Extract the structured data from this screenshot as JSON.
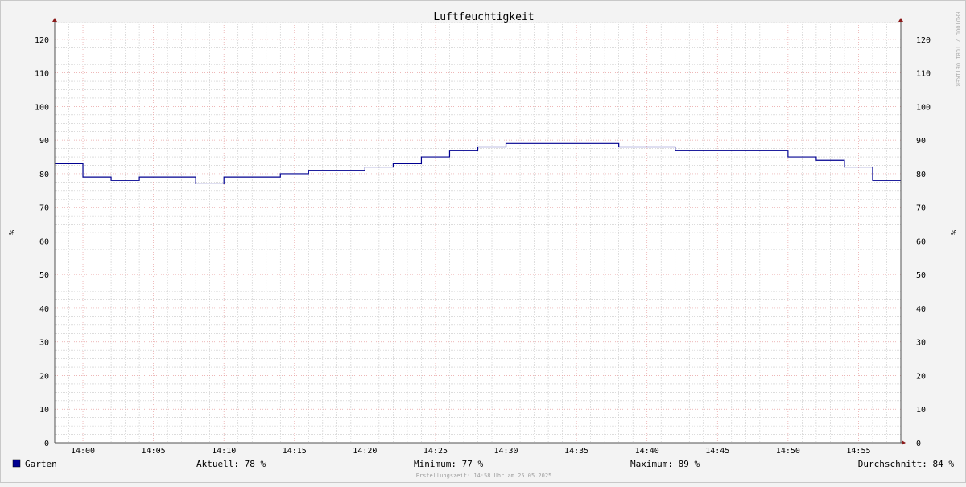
{
  "chart_data": {
    "type": "line",
    "title": "Luftfeuchtigkeit",
    "ylabel": "%",
    "ylabel_right": "%",
    "ylim": [
      0,
      125
    ],
    "y_ticks": [
      0,
      10,
      20,
      30,
      40,
      50,
      60,
      70,
      80,
      90,
      100,
      110,
      120
    ],
    "x_range": [
      "13:58",
      "14:58"
    ],
    "x_ticks": [
      "14:00",
      "14:05",
      "14:10",
      "14:15",
      "14:20",
      "14:25",
      "14:30",
      "14:35",
      "14:40",
      "14:45",
      "14:50",
      "14:55"
    ],
    "grid": true,
    "step": true,
    "series": [
      {
        "name": "Garten",
        "color": "#000090",
        "points": [
          [
            "13:58",
            83
          ],
          [
            "14:00",
            79
          ],
          [
            "14:02",
            78
          ],
          [
            "14:04",
            79
          ],
          [
            "14:08",
            77
          ],
          [
            "14:10",
            79
          ],
          [
            "14:14",
            80
          ],
          [
            "14:16",
            81
          ],
          [
            "14:20",
            82
          ],
          [
            "14:22",
            83
          ],
          [
            "14:24",
            85
          ],
          [
            "14:26",
            87
          ],
          [
            "14:28",
            88
          ],
          [
            "14:30",
            89
          ],
          [
            "14:38",
            88
          ],
          [
            "14:42",
            87
          ],
          [
            "14:50",
            85
          ],
          [
            "14:52",
            84
          ],
          [
            "14:54",
            82
          ],
          [
            "14:56",
            78
          ],
          [
            "14:58",
            78
          ]
        ]
      }
    ]
  },
  "legend": {
    "series_name": "Garten",
    "swatch_color": "#000090",
    "aktuell": "Aktuell:  78 %",
    "minimum": "Minimum:  77 %",
    "maximum": "Maximum:  89 %",
    "durchschnitt": "Durchschnitt:  84 %"
  },
  "footer": "Erstellungszeit: 14:58 Uhr am 25.05.2025",
  "watermark": "RRDTOOL / TOBI OETIKER"
}
